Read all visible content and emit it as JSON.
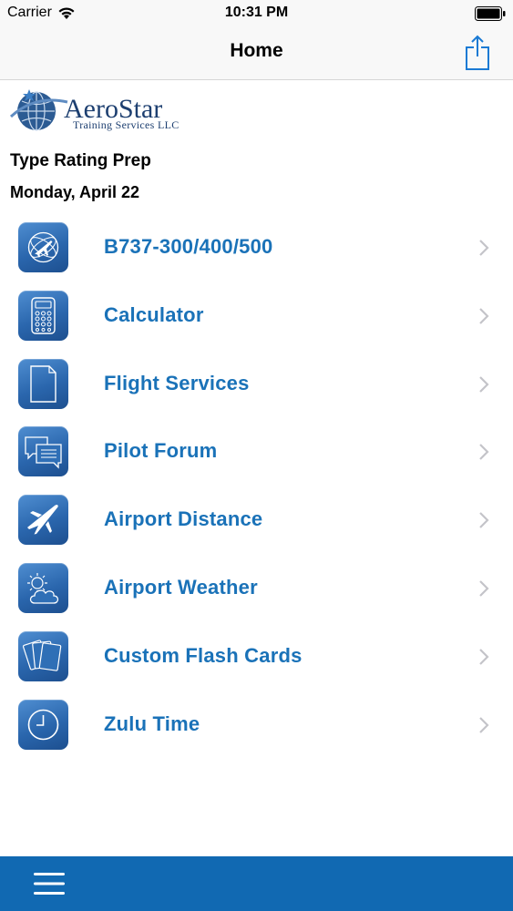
{
  "status_bar": {
    "carrier": "Carrier",
    "time": "10:31 PM"
  },
  "nav": {
    "title": "Home"
  },
  "logo": {
    "brand": "AeroStar",
    "subtitle": "Training Services LLC"
  },
  "header": {
    "app_name": "Type Rating Prep",
    "date": "Monday, April 22"
  },
  "menu": [
    {
      "label": "B737-300/400/500",
      "icon": "airplane-globe-icon"
    },
    {
      "label": "Calculator",
      "icon": "calculator-icon"
    },
    {
      "label": "Flight Services",
      "icon": "document-icon"
    },
    {
      "label": "Pilot Forum",
      "icon": "chat-bubbles-icon"
    },
    {
      "label": "Airport Distance",
      "icon": "airplane-icon"
    },
    {
      "label": "Airport Weather",
      "icon": "weather-icon"
    },
    {
      "label": "Custom Flash Cards",
      "icon": "flash-cards-icon"
    },
    {
      "label": "Zulu Time",
      "icon": "clock-icon"
    }
  ],
  "colors": {
    "accent": "#1a72b8",
    "tab_bar": "#1169b2",
    "icon_bg": "#2a66ad"
  }
}
